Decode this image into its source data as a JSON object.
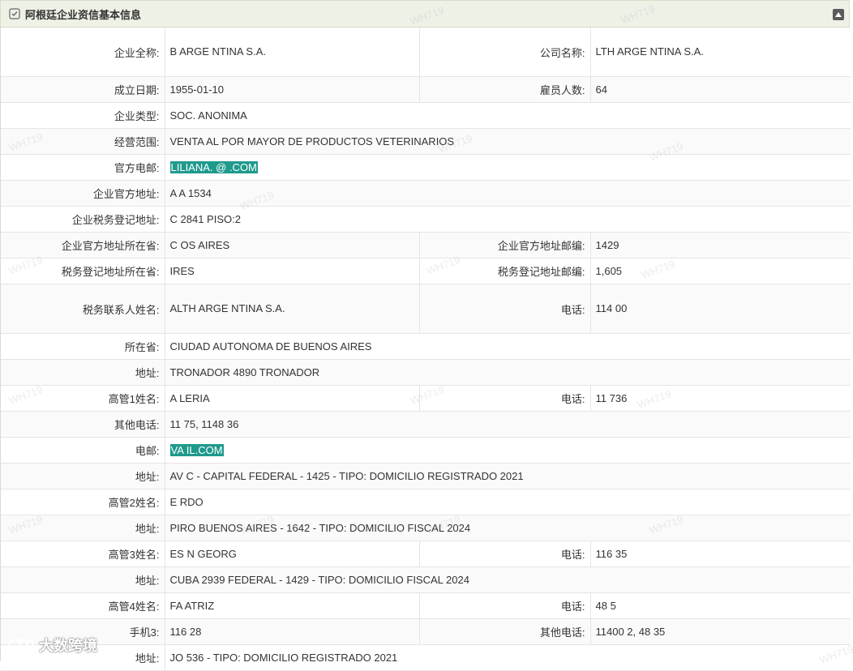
{
  "header": {
    "title": "阿根廷企业资信基本信息",
    "icon": "checklist-icon",
    "collapse_icon": "caret-up-icon"
  },
  "rows": [
    {
      "type": "pair",
      "tall": true,
      "l1": "企业全称:",
      "v1": "B                                        ARGE NTINA S.A.",
      "l2": "公司名称:",
      "v2": "                                     LTH ARGE NTINA S.A."
    },
    {
      "type": "pair",
      "l1": "成立日期:",
      "v1": "1955-01-10",
      "l2": "雇员人数:",
      "v2": "64"
    },
    {
      "type": "single",
      "l1": "企业类型:",
      "v1": "SOC. ANONIMA"
    },
    {
      "type": "single",
      "l1": "经营范围:",
      "v1": "VENTA AL POR MAYOR DE PRODUCTOS VETERINARIOS"
    },
    {
      "type": "single",
      "l1": "官方电邮:",
      "v1": "LILIANA.         @       .COM",
      "highlight": true
    },
    {
      "type": "single",
      "l1": "企业官方地址:",
      "v1": "A                A 1534"
    },
    {
      "type": "single",
      "l1": "企业税务登记地址:",
      "v1": "C                                2841 PISO:2"
    },
    {
      "type": "pair",
      "l1": "企业官方地址所在省:",
      "v1": "C                          OS AIRES",
      "l2": "企业官方地址邮编:",
      "v2": "1429"
    },
    {
      "type": "pair",
      "l1": "税务登记地址所在省:",
      "v1": "           IRES",
      "l2": "税务登记地址邮编:",
      "v2": "1,605"
    },
    {
      "type": "pair",
      "tall": true,
      "l1": "税务联系人姓名:",
      "v1": "                              ALTH ARGE NTINA S.A.",
      "l2": "电话:",
      "v2": "114        00"
    },
    {
      "type": "single",
      "l1": "所在省:",
      "v1": "CIUDAD AUTONOMA DE BUENOS AIRES"
    },
    {
      "type": "single",
      "l1": "地址:",
      "v1": "TRONADOR 4890 TRONADOR"
    },
    {
      "type": "pair",
      "l1": "高管1姓名:",
      "v1": "A          LERIA",
      "l2": "电话:",
      "v2": "11         736"
    },
    {
      "type": "single",
      "l1": "其他电话:",
      "v1": "11        75, 1148        36"
    },
    {
      "type": "single",
      "l1": "电邮:",
      "v1": "VA              IL.COM",
      "highlight": true
    },
    {
      "type": "single",
      "l1": "地址:",
      "v1": "AV C                                          - CAPITAL FEDERAL - 1425 - TIPO: DOMICILIO REGISTRADO 2021"
    },
    {
      "type": "single",
      "l1": "高管2姓名:",
      "v1": "E               RDO"
    },
    {
      "type": "single",
      "l1": "地址:",
      "v1": "PIRO                                 BUENOS AIRES - 1642 - TIPO: DOMICILIO FISCAL 2024"
    },
    {
      "type": "pair",
      "l1": "高管3姓名:",
      "v1": "ES                          N GEORG",
      "l2": "电话:",
      "v2": "116        35"
    },
    {
      "type": "single",
      "l1": "地址:",
      "v1": "CUBA 2939                                        FEDERAL - 1429 - TIPO: DOMICILIO FISCAL 2024"
    },
    {
      "type": "pair",
      "l1": "高管4姓名:",
      "v1": "FA                   ATRIZ",
      "l2": "电话:",
      "v2": "48         5"
    },
    {
      "type": "pair",
      "l1": "手机3:",
      "v1": "116       28",
      "l2": "其他电话:",
      "v2": "11400       2, 48        35"
    },
    {
      "type": "single",
      "l1": "地址:",
      "v1": "JO                                               536 - TIPO: DOMICILIO REGISTRADO 2021"
    }
  ],
  "watermark": "WH719",
  "logo_text": "大数跨境",
  "colors": {
    "header_bg": "#eef1e6",
    "highlight": "#1f9a8c",
    "border": "#e5e5e5"
  }
}
